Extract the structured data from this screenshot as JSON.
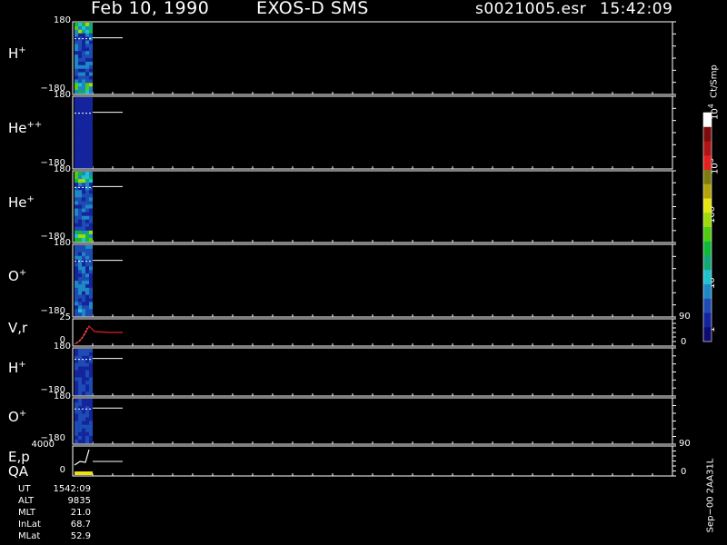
{
  "header": {
    "date": "Feb 10, 1990",
    "mission": "EXOS-D SMS",
    "file": "s0021005.esr",
    "time": "15:42:09"
  },
  "panels": [
    {
      "label": "H",
      "sup": "+",
      "top": "180",
      "bottom": "−180"
    },
    {
      "label": "He",
      "sup": "++",
      "top": "180",
      "bottom": "−180"
    },
    {
      "label": "He",
      "sup": "+",
      "top": "180",
      "bottom": "−180"
    },
    {
      "label": "O",
      "sup": "+",
      "top": "180",
      "bottom": "−180"
    },
    {
      "label": "V,r",
      "sup": "",
      "top": "25",
      "bottom": "0",
      "right_top": "90",
      "right_bottom": "0"
    },
    {
      "label": "H",
      "sup": "+",
      "top": "180",
      "bottom": "−180"
    },
    {
      "label": "O",
      "sup": "+",
      "top": "180",
      "bottom": "−180"
    },
    {
      "label": "E,p",
      "label2": "QA",
      "sup": "",
      "top": "4000",
      "bottom": "0",
      "right_top": "90",
      "right_bottom": "0"
    }
  ],
  "colorbar": {
    "unit": "Ct/Smp",
    "ticks": [
      "1",
      "10",
      "100",
      "10",
      "10"
    ],
    "tick_sups": [
      "",
      "",
      "",
      "3",
      "4"
    ],
    "colors": [
      "#0c0c6e",
      "#14249c",
      "#1c4cb4",
      "#1e88c4",
      "#22c0d0",
      "#12a878",
      "#10b83c",
      "#50cc14",
      "#9cdc0c",
      "#e6e610",
      "#b4a40c",
      "#7c7c10",
      "#e42020",
      "#b01414",
      "#7c0c0c",
      "#ffffff"
    ]
  },
  "ephemeris": {
    "rows": [
      {
        "label": "UT",
        "value": "1542:09"
      },
      {
        "label": "ALT",
        "value": "9835"
      },
      {
        "label": "MLT",
        "value": "21.0"
      },
      {
        "label": "InLat",
        "value": "68.7"
      },
      {
        "label": "MLat",
        "value": "52.9"
      }
    ]
  },
  "footer_id": "Sep−00 2AA31L",
  "chart_data": {
    "type": "heatmap",
    "title": "Feb 10, 1990   EXOS-D SMS",
    "x_extent_fraction": 0.03,
    "panels": [
      "H+",
      "He++",
      "He+",
      "O+",
      "V,r",
      "H+",
      "O+",
      "E,p / QA"
    ],
    "pitch_angle_range": [
      -180,
      180
    ],
    "vr_range": [
      0,
      25
    ],
    "ep_range": [
      0,
      4000
    ],
    "right_axis_range": [
      0,
      90
    ],
    "colorbar_range": [
      "1",
      "10^4"
    ],
    "colorbar_label": "Ct/Smp"
  }
}
